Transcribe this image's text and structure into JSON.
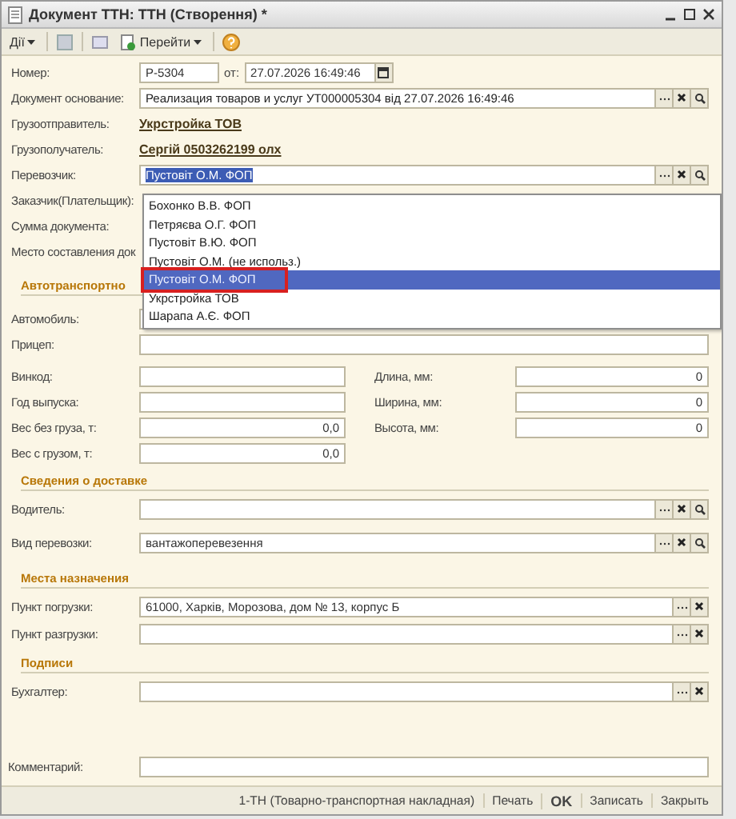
{
  "window": {
    "title": "Документ ТТН: ТТН (Створення) *"
  },
  "toolbar": {
    "actions": "Дії",
    "goto": "Перейти"
  },
  "number": {
    "label": "Номер:",
    "value": "P-5304",
    "date_label": "от:",
    "date": "27.07.2026 16:49:46"
  },
  "header_rows": [
    {
      "kind": "field",
      "label": "Документ основание:",
      "value": "Реализация товаров и услуг УТ000005304 від 27.07.2026 16:49:46",
      "search_button": true
    },
    {
      "kind": "link",
      "label": "Грузоотправитель:",
      "value": "Укрстройка ТОВ"
    },
    {
      "kind": "link",
      "label": "Грузополучатель:",
      "value": "Сергій 0503262199 олх"
    },
    {
      "kind": "field",
      "label": "Перевозчик:",
      "value": "Пустовіт О.М. ФОП",
      "selected_text": true,
      "search_button": true
    },
    {
      "kind": "label",
      "label": "Заказчик(Плательщик):"
    },
    {
      "kind": "label",
      "label": "Сумма документа:"
    },
    {
      "kind": "label",
      "label": "Место составления док"
    }
  ],
  "dropdown": {
    "items": [
      {
        "label": "Бохонко В.В. ФОП",
        "selected": false,
        "highlighted": false
      },
      {
        "label": "Петряєва О.Г. ФОП",
        "selected": false,
        "highlighted": false
      },
      {
        "label": "Пустовіт В.Ю. ФОП",
        "selected": false,
        "highlighted": false
      },
      {
        "label": "Пустовіт О.М. (не использ.)",
        "selected": false,
        "highlighted": false
      },
      {
        "label": "Пустовіт О.М. ФОП",
        "selected": true,
        "highlighted": true
      },
      {
        "label": "Укрстройка ТОВ",
        "selected": false,
        "highlighted": false
      },
      {
        "label": "Шарапа А.Є. ФОП",
        "selected": false,
        "highlighted": false
      }
    ]
  },
  "vehicle": {
    "title": "Автотранспортно",
    "car_label": "Автомобиль:",
    "trailer_label": "Прицеп:",
    "left": [
      {
        "label": "Винкод:"
      },
      {
        "label": "Год выпуска:"
      },
      {
        "label": "Вес без груза, т:",
        "value": "0,0"
      },
      {
        "label": "Вес с грузом, т:",
        "value": "0,0"
      }
    ],
    "right": [
      {
        "label": "Длина, мм:",
        "value": "0"
      },
      {
        "label": "Ширина, мм:",
        "value": "0"
      },
      {
        "label": "Высота, мм:",
        "value": "0"
      }
    ]
  },
  "sections": [
    {
      "title": "Сведения о доставке",
      "rows": [
        {
          "label": "Водитель:",
          "search_button": true
        },
        {
          "label": "Вид перевозки:",
          "value": "вантажоперевезення",
          "search_button": true
        }
      ]
    },
    {
      "title": "Места назначения",
      "rows": [
        {
          "label": "Пункт погрузки:",
          "value": "61000, Харків, Морозова, дом № 13, корпус Б",
          "search_button": false
        },
        {
          "label": "Пункт разгрузки:",
          "search_button": false
        }
      ]
    },
    {
      "title": "Подписи",
      "rows": [
        {
          "label": "Бухгалтер:",
          "search_button": false
        }
      ]
    }
  ],
  "comment": {
    "label": "Комментарий:"
  },
  "footer": [
    {
      "label": "1-ТН (Товарно-транспортная накладная)",
      "default": false
    },
    {
      "label": "Печать",
      "default": false
    },
    {
      "label": "OK",
      "default": true
    },
    {
      "label": "Записать",
      "default": false
    },
    {
      "label": "Закрыть",
      "default": false
    }
  ]
}
